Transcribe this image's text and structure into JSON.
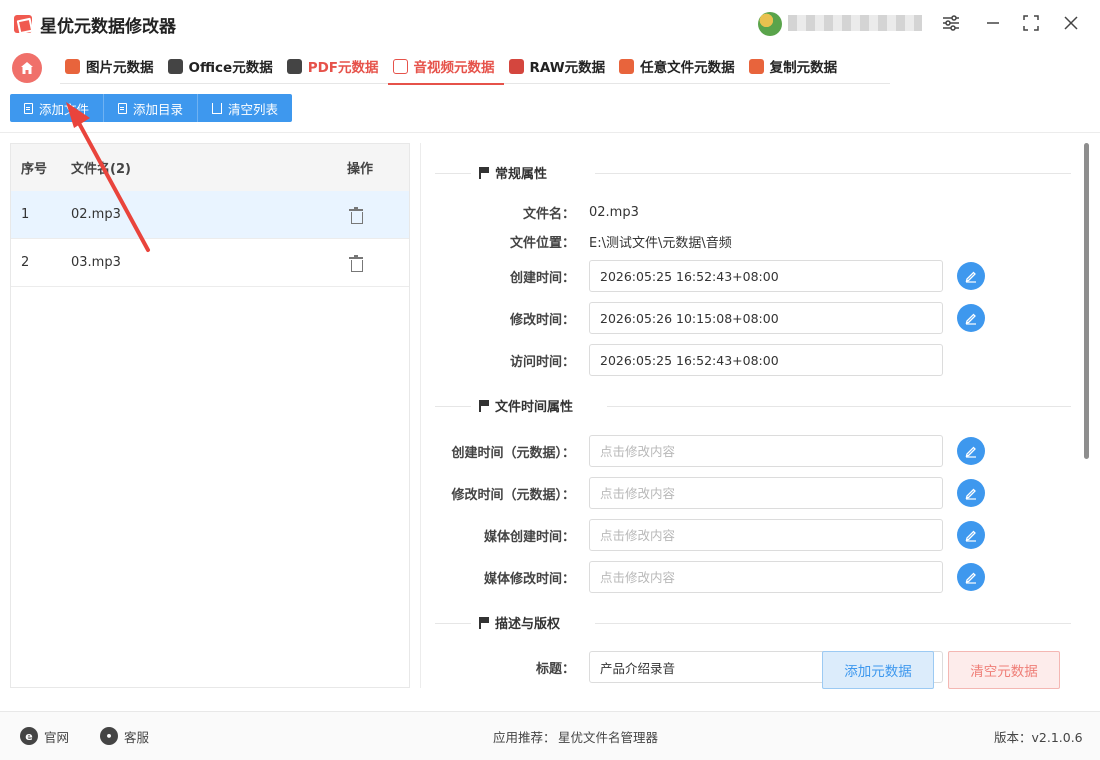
{
  "app": {
    "title": "星优元数据修改器"
  },
  "nav": {
    "tabs": [
      {
        "label": "图片元数据",
        "icon": "image-icon",
        "color": "#e8643c"
      },
      {
        "label": "Office元数据",
        "icon": "office-icon",
        "color": "#444444"
      },
      {
        "label": "PDF元数据",
        "icon": "pdf-icon",
        "color": "#444444"
      },
      {
        "label": "音视频元数据",
        "icon": "video-icon",
        "color": "#e6524a"
      },
      {
        "label": "RAW元数据",
        "icon": "raw-icon",
        "color": "#d4463e"
      },
      {
        "label": "任意文件元数据",
        "icon": "file-icon",
        "color": "#e8643c"
      },
      {
        "label": "复制元数据",
        "icon": "copy-icon",
        "color": "#e8643c"
      }
    ]
  },
  "toolbar": {
    "add_file": "添加文件",
    "add_dir": "添加目录",
    "clear_list": "清空列表"
  },
  "filelist": {
    "headers": {
      "index": "序号",
      "name": "文件名(2)",
      "action": "操作"
    },
    "rows": [
      {
        "index": "1",
        "name": "02.mp3"
      },
      {
        "index": "2",
        "name": "03.mp3"
      }
    ]
  },
  "detail": {
    "general_title": "常规属性",
    "file_name_label": "文件名：",
    "file_name": "02.mp3",
    "location_label": "文件位置：",
    "location": "E:\\测试文件\\元数据\\音频",
    "created_label": "创建时间：",
    "created": "2026:05:25 16:52:43+08:00",
    "modified_label": "修改时间：",
    "modified": "2026:05:26 10:15:08+08:00",
    "accessed_label": "访问时间：",
    "accessed": "2026:05:25 16:52:43+08:00",
    "time_title": "文件时间属性",
    "meta_created_label": "创建时间（元数据）：",
    "meta_modified_label": "修改时间（元数据）：",
    "media_created_label": "媒体创建时间：",
    "media_modified_label": "媒体修改时间：",
    "placeholder": "点击修改内容",
    "desc_title": "描述与版权",
    "title_label": "标题：",
    "title_value": "产品介绍录音"
  },
  "actions": {
    "add_meta": "添加元数据",
    "clear_meta": "清空元数据"
  },
  "footer": {
    "website": "官网",
    "support": "客服",
    "recommend": "应用推荐：",
    "recommend_app": "星优文件名管理器",
    "version": "版本：v2.1.0.6"
  },
  "colors": {
    "accent": "#3e98ee",
    "brand": "#e6524a"
  }
}
